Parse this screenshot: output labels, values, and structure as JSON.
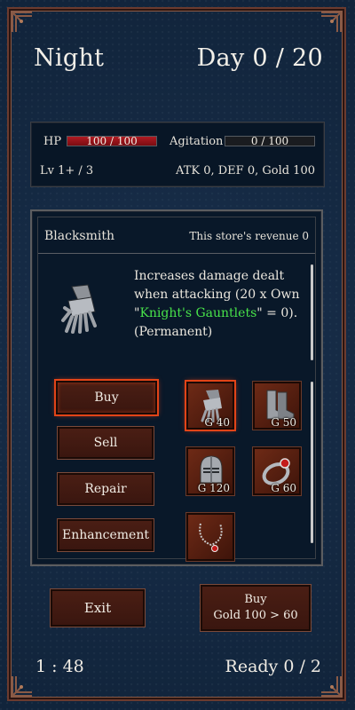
{
  "header": {
    "phase": "Night",
    "day": "Day 0 / 20"
  },
  "status": {
    "hp_label": "HP",
    "hp_text": "100 / 100",
    "hp_fraction": 1.0,
    "agitation_label": "Agitation",
    "agitation_text": "0 / 100",
    "agitation_fraction": 0.0,
    "level": "Lv 1+ / 3",
    "stats": "ATK 0, DEF 0, Gold 100"
  },
  "store": {
    "title": "Blacksmith",
    "revenue": "This store's revenue 0",
    "description_pre": "Increases damage dealt when attacking (20 x  Own \"",
    "description_item": "Knight's Gauntlets",
    "description_post": "\" = 0). (Permanent)",
    "actions": [
      "Buy",
      "Sell",
      "Repair",
      "Enhancement"
    ],
    "items": [
      {
        "icon": "gauntlet-icon",
        "price": "G 40"
      },
      {
        "icon": "boots-icon",
        "price": "G 50"
      },
      {
        "icon": "helmet-icon",
        "price": "G 120"
      },
      {
        "icon": "ring-icon",
        "price": "G 60"
      },
      {
        "icon": "necklace-icon",
        "price": ""
      }
    ]
  },
  "footer": {
    "exit_label": "Exit",
    "buy_label": "Buy",
    "buy_detail": "Gold 100 > 60",
    "timer": "1 : 48",
    "ready": "Ready 0 / 2"
  },
  "colors": {
    "highlight": "#e24418",
    "hp_bar": "#b01b22",
    "item_name": "#48e24a"
  }
}
